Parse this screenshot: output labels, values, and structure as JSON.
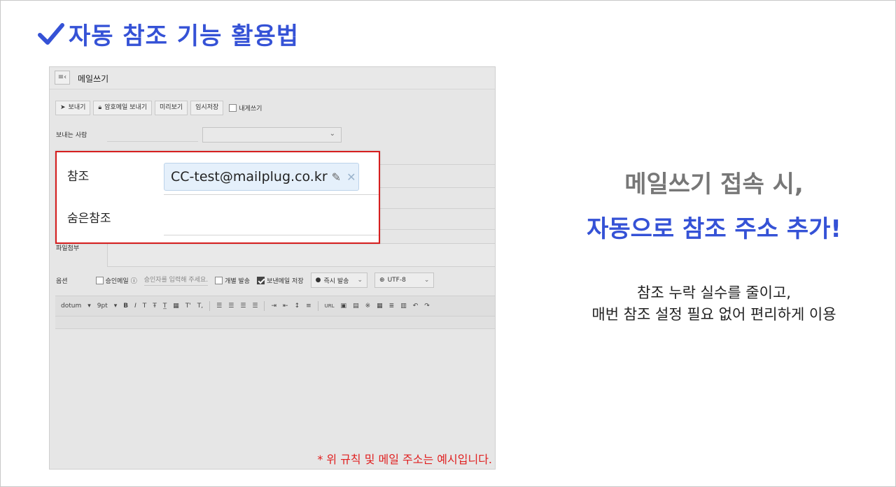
{
  "slide": {
    "title": "자동 참조 기능 활용법",
    "headline_1": "메일쓰기 접속 시,",
    "headline_2": "자동으로 참조 주소 추가!",
    "desc_line_1": "참조 누락 실수를 줄이고,",
    "desc_line_2": "매번 참조 설정 필요 없어 편리하게 이용",
    "accent_color": "#3552d6"
  },
  "mail": {
    "menu_icon": "≡‹",
    "window_title": "메일쓰기",
    "toolbar": {
      "send": "보내기",
      "encrypted_send": "암호메일 보내기",
      "preview": "미리보기",
      "save_draft": "임시저장",
      "write_to_me": "내게쓰기"
    },
    "sender_label": "보내는 사람",
    "attach_label": "파일첨부",
    "options": {
      "label": "옵션",
      "approval_mail": "승인메일",
      "approver_placeholder": "승인자를 입력해 주세요.",
      "individual_send": "개별 발송",
      "save_sent": "보낸메일 저장",
      "send_timing": "즉시 발송",
      "encoding": "UTF-8"
    },
    "editor": {
      "font": "dotum",
      "size": "9pt",
      "format_tools": [
        "B",
        "I",
        "T",
        "Ŧ",
        "T̲",
        "▦",
        "T'",
        "T,"
      ],
      "url_tool": "URL",
      "undo": "↶",
      "redo": "↷"
    },
    "popup": {
      "cc_label": "참조",
      "cc_address": "CC-test@mailplug.co.kr",
      "bcc_label": "숨은참조"
    },
    "note": "* 위 규칙 및 메일 주소는 예시입니다."
  }
}
